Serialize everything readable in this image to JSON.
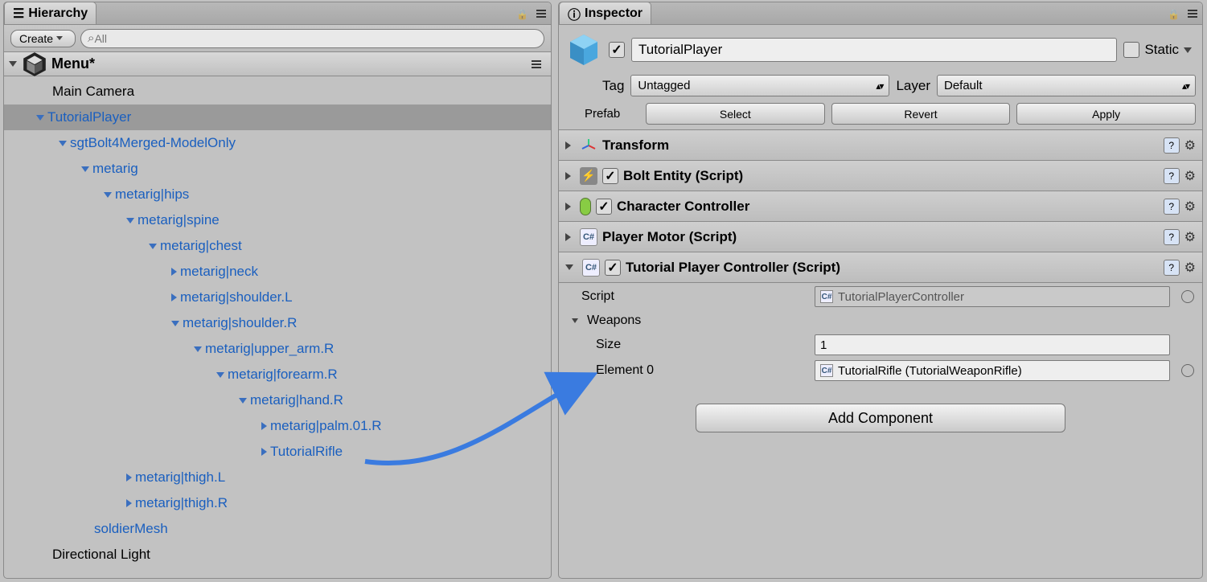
{
  "hierarchy": {
    "tab_title": "Hierarchy",
    "create_label": "Create",
    "search_placeholder": "All",
    "scene_name": "Menu*",
    "items": {
      "main_camera": "Main Camera",
      "tutorial_player": "TutorialPlayer",
      "model": "sgtBolt4Merged-ModelOnly",
      "metarig": "metarig",
      "hips": "metarig|hips",
      "spine": "metarig|spine",
      "chest": "metarig|chest",
      "neck": "metarig|neck",
      "shoulderL": "metarig|shoulder.L",
      "shoulderR": "metarig|shoulder.R",
      "upper_armR": "metarig|upper_arm.R",
      "forearmR": "metarig|forearm.R",
      "handR": "metarig|hand.R",
      "palm01R": "metarig|palm.01.R",
      "tutorial_rifle": "TutorialRifle",
      "thighL": "metarig|thigh.L",
      "thighR": "metarig|thigh.R",
      "soldier_mesh": "soldierMesh",
      "directional_light": "Directional Light"
    }
  },
  "inspector": {
    "tab_title": "Inspector",
    "name": "TutorialPlayer",
    "static_label": "Static",
    "tag_label": "Tag",
    "tag_value": "Untagged",
    "layer_label": "Layer",
    "layer_value": "Default",
    "prefab_label": "Prefab",
    "prefab_select": "Select",
    "prefab_revert": "Revert",
    "prefab_apply": "Apply",
    "components": {
      "transform": "Transform",
      "bolt_entity": "Bolt Entity (Script)",
      "char_controller": "Character Controller",
      "player_motor": "Player Motor (Script)",
      "tpc": {
        "title": "Tutorial Player Controller (Script)",
        "script_label": "Script",
        "script_value": "TutorialPlayerController",
        "weapons_label": "Weapons",
        "size_label": "Size",
        "size_value": "1",
        "el0_label": "Element 0",
        "el0_value": "TutorialRifle (TutorialWeaponRifle)"
      }
    },
    "add_component": "Add Component"
  }
}
